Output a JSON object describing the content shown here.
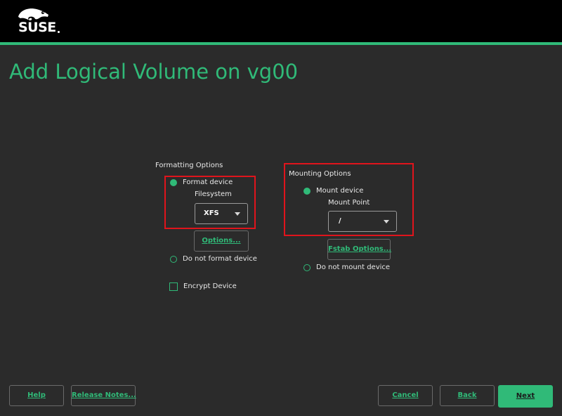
{
  "brand": {
    "name": "SUSE",
    "accent_color": "#30ba78",
    "header_color": "#000000",
    "background_color": "#2b2b2b",
    "highlight_color": "#e0141c",
    "logo_icon": "chameleon-icon"
  },
  "page": {
    "title": "Add Logical Volume on vg00"
  },
  "formatting": {
    "heading": "Formatting Options",
    "format_device_label": "Format device",
    "format_device_selected": true,
    "filesystem_label": "Filesystem",
    "filesystem_value": "XFS",
    "options_button": "Options...",
    "do_not_format_label": "Do not format device",
    "do_not_format_selected": false,
    "encrypt_label": "Encrypt Device",
    "encrypt_checked": false
  },
  "mounting": {
    "heading": "Mounting Options",
    "mount_device_label": "Mount device",
    "mount_device_selected": true,
    "mount_point_label": "Mount Point",
    "mount_point_value": "/",
    "fstab_button": "Fstab Options...",
    "do_not_mount_label": "Do not mount device",
    "do_not_mount_selected": false
  },
  "footer": {
    "help": "Help",
    "release_notes": "Release Notes...",
    "cancel": "Cancel",
    "back": "Back",
    "next": "Next"
  }
}
